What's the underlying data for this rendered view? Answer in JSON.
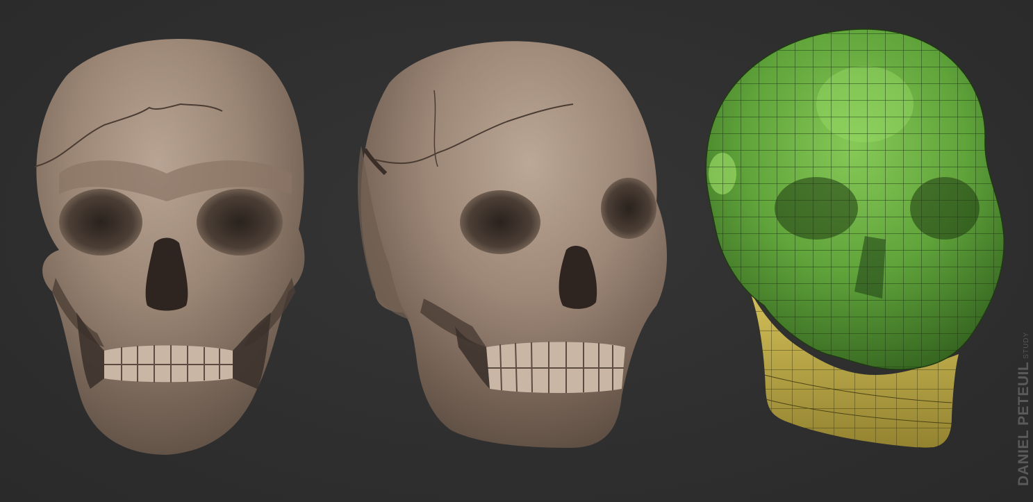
{
  "watermark": {
    "name": "DANIEL PETEUIL",
    "suffix": "STUDY"
  },
  "colors": {
    "background": "#2f2f2f",
    "clay": "#9a8574",
    "mesh_green": "#5fa33a",
    "mesh_yellow": "#c7b24a"
  },
  "renders": [
    {
      "id": "skull-front-sculpt",
      "material": "clay"
    },
    {
      "id": "skull-three-quarter-sculpt",
      "material": "clay"
    },
    {
      "id": "skull-lowpoly-mesh",
      "material": "wireframe"
    }
  ]
}
